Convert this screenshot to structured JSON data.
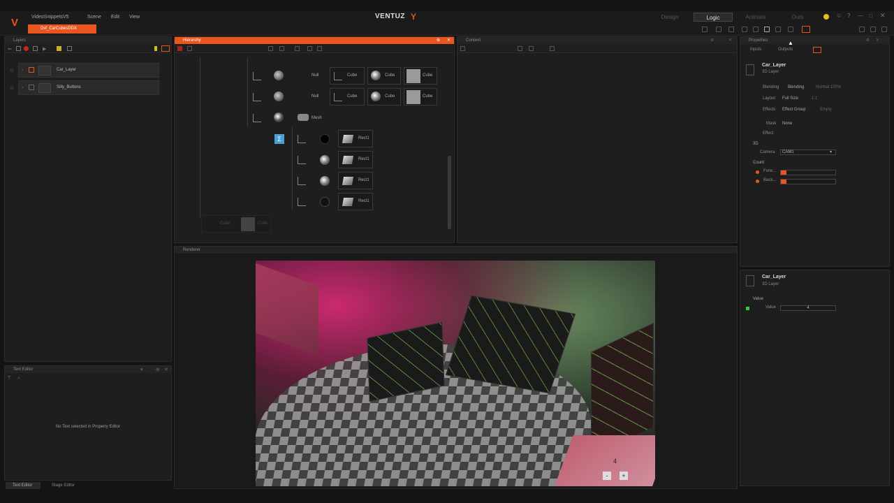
{
  "app": {
    "project_name": "VideoSnippetsV5",
    "brand": "VENTUZ",
    "menu": [
      "Scene",
      "Edit",
      "View"
    ],
    "open_file": "Dvf_CarCubesDDX",
    "modes": [
      "Design",
      "Logic",
      "Animate",
      "Outs"
    ],
    "active_mode": "Logic"
  },
  "layers_panel": {
    "title": "Layers",
    "items": [
      {
        "label": "Car_Layer"
      },
      {
        "label": "Silly_Buttons"
      }
    ]
  },
  "text_editor": {
    "title": "Text Editor",
    "empty_message": "No Text selected in Property Editor",
    "bottom_tabs": [
      "Text Editor",
      "Stage Editor"
    ]
  },
  "hierarchy": {
    "title": "Hierarchy",
    "nodes": {
      "null": "Null",
      "cube": "Cube",
      "mesh": "Mesh",
      "rect": "Rect1"
    }
  },
  "content_panel": {
    "title": "Content"
  },
  "renderer": {
    "title": "Renderer",
    "overlay_number": "4"
  },
  "properties": {
    "title": "Properties",
    "tabs": [
      "Inputs",
      "Outputs"
    ],
    "layer_name": "Car_Layer",
    "layer_type": "3D Layer",
    "blending_label": "Blending",
    "blending_value": "Blending",
    "blending_mode": "Normal 100%",
    "layout_label": "Layout",
    "layout_value": "Full Size",
    "layout_extra": "1:1",
    "effects_label": "Effects",
    "effects_value": "Effect Group",
    "effects_extra": "Empty",
    "mask_label": "Mask",
    "mask_value": "None",
    "effect_label": "Effect",
    "section_3d": "3D",
    "camera_label": "Camera",
    "camera_value": "CAM1",
    "count_label": "Count",
    "rows": [
      {
        "label": "Forw..."
      },
      {
        "label": "Back..."
      }
    ],
    "lower": {
      "layer_name": "Car_Layer",
      "layer_type": "3D Layer",
      "section": "Value",
      "value_label": "Value",
      "value": "4"
    }
  },
  "colors": {
    "accent": "#e8561e",
    "panel_bg": "#1e1e1e",
    "header_bg": "#242424"
  }
}
